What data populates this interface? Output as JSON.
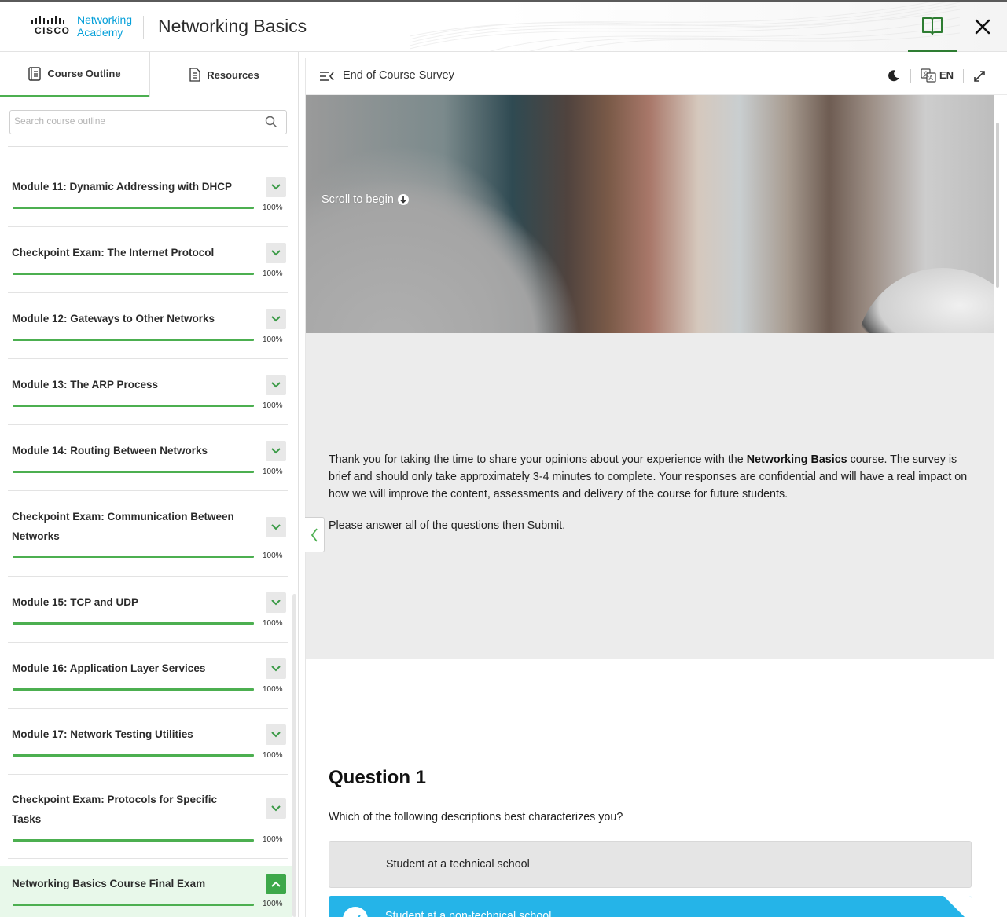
{
  "header": {
    "brand_line1": "Networking",
    "brand_line2": "Academy",
    "brand_cisco": "CISCO",
    "title": "Networking Basics"
  },
  "sidebar": {
    "tabs": [
      {
        "label": "Course Outline",
        "active": true
      },
      {
        "label": "Resources",
        "active": false
      }
    ],
    "search_placeholder": "Search course outline",
    "items": [
      {
        "title": "Module 11: Dynamic Addressing with DHCP",
        "progress": "100%"
      },
      {
        "title": "Checkpoint Exam: The Internet Protocol",
        "progress": "100%"
      },
      {
        "title": "Module 12: Gateways to Other Networks",
        "progress": "100%"
      },
      {
        "title": "Module 13: The ARP Process",
        "progress": "100%"
      },
      {
        "title": "Module 14: Routing Between Networks",
        "progress": "100%"
      },
      {
        "title": "Checkpoint Exam: Communication Between Networks",
        "progress": "100%"
      },
      {
        "title": "Module 15: TCP and UDP",
        "progress": "100%"
      },
      {
        "title": "Module 16: Application Layer Services",
        "progress": "100%"
      },
      {
        "title": "Module 17: Network Testing Utilities",
        "progress": "100%"
      },
      {
        "title": "Checkpoint Exam: Protocols for Specific Tasks",
        "progress": "100%"
      },
      {
        "title": "Networking Basics Course Final Exam",
        "progress": "100%",
        "active": true
      }
    ]
  },
  "main": {
    "title": "End of Course Survey",
    "language": "EN",
    "hero_scroll": "Scroll to begin",
    "intro_pre": "Thank you for taking the time to share your opinions about your experience with the ",
    "intro_bold": "Networking Basics",
    "intro_post": " course. The survey is brief and should only take approximately 3-4 minutes to complete. Your responses are confidential and will have a real impact on how we will improve the content, assessments and delivery of the course for future students.",
    "intro2": "Please answer all of the questions then Submit.",
    "question_title": "Question 1",
    "question_text": "Which of the following descriptions best characterizes you?",
    "options": [
      {
        "label": "Student at a technical school",
        "selected": false
      },
      {
        "label": "Student at a non-technical school",
        "selected": true
      }
    ]
  },
  "colors": {
    "accent_green": "#4caf50",
    "selected_blue": "#25b4e8",
    "cisco_blue": "#049fd9"
  }
}
